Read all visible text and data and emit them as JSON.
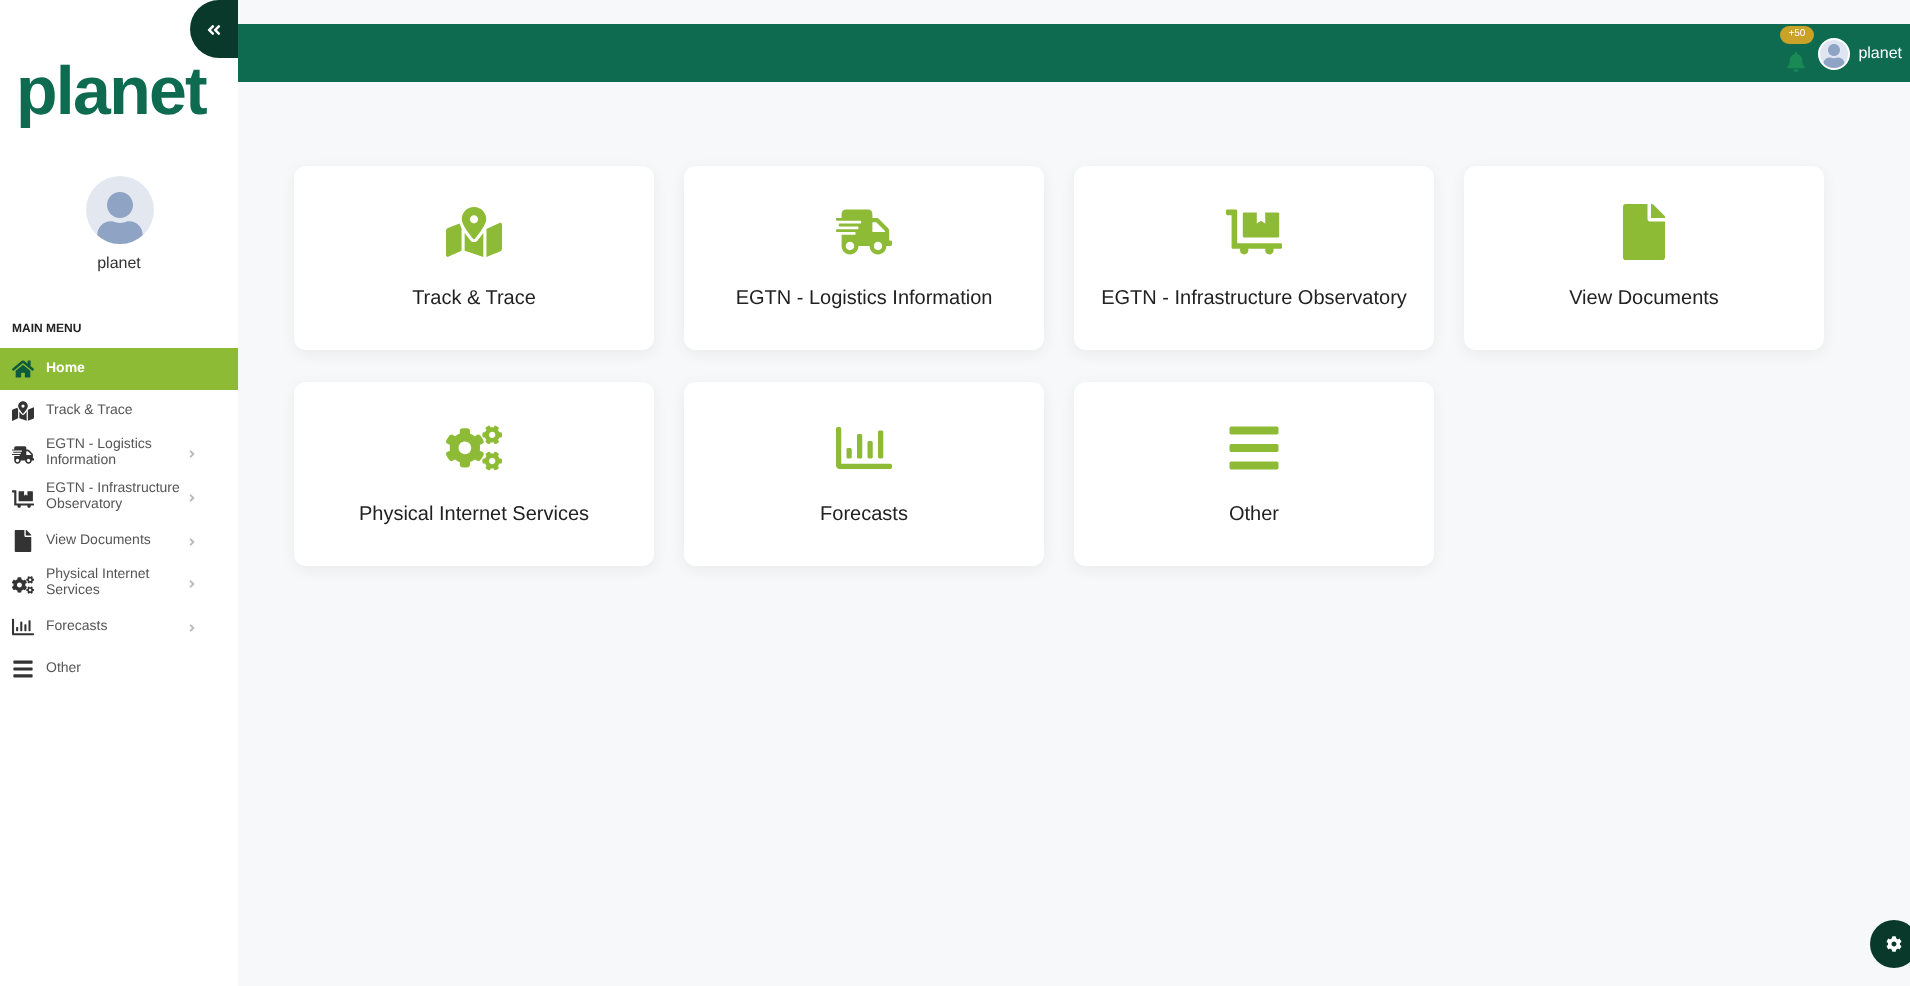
{
  "logo": "planet",
  "user": {
    "name": "planet"
  },
  "topbar": {
    "badge": "+50",
    "user_name": "planet"
  },
  "sidebar": {
    "heading": "MAIN MENU",
    "items": [
      {
        "label": "Home",
        "selected": true,
        "submenu": false
      },
      {
        "label": "Track & Trace",
        "selected": false,
        "submenu": false
      },
      {
        "label": "EGTN - Logistics Information",
        "selected": false,
        "submenu": true
      },
      {
        "label": "EGTN - Infrastructure Observatory",
        "selected": false,
        "submenu": true
      },
      {
        "label": "View Documents",
        "selected": false,
        "submenu": true
      },
      {
        "label": "Physical Internet Services",
        "selected": false,
        "submenu": true
      },
      {
        "label": "Forecasts",
        "selected": false,
        "submenu": true
      },
      {
        "label": "Other",
        "selected": false,
        "submenu": false
      }
    ]
  },
  "tiles": [
    {
      "label": "Track & Trace"
    },
    {
      "label": "EGTN - Logistics Information"
    },
    {
      "label": "EGTN - Infrastructure Observatory"
    },
    {
      "label": "View Documents"
    },
    {
      "label": "Physical Internet Services"
    },
    {
      "label": "Forecasts"
    },
    {
      "label": "Other"
    }
  ]
}
